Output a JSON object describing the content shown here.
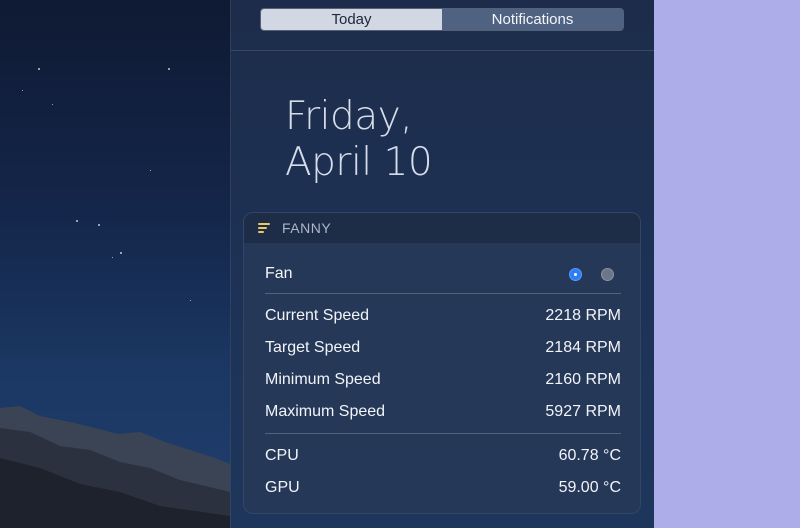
{
  "tabs": [
    {
      "label": "Today",
      "active": true
    },
    {
      "label": "Notifications",
      "active": false
    }
  ],
  "date": {
    "line1": "Friday,",
    "line2": "April 10"
  },
  "widget": {
    "title": "FANNY",
    "icon": "fanny-app-icon",
    "fan_label": "Fan",
    "fan_pages": 2,
    "fan_selected": 1,
    "speeds": [
      {
        "label": "Current Speed",
        "value": "2218 RPM"
      },
      {
        "label": "Target Speed",
        "value": "2184 RPM"
      },
      {
        "label": "Minimum Speed",
        "value": "2160 RPM"
      },
      {
        "label": "Maximum Speed",
        "value": "5927 RPM"
      }
    ],
    "temps": [
      {
        "label": "CPU",
        "value": "60.78 °C"
      },
      {
        "label": "GPU",
        "value": "59.00 °C"
      }
    ]
  },
  "colors": {
    "accent": "#2e7cf6",
    "panel": "#1d3256",
    "side_background": "#adadea"
  }
}
